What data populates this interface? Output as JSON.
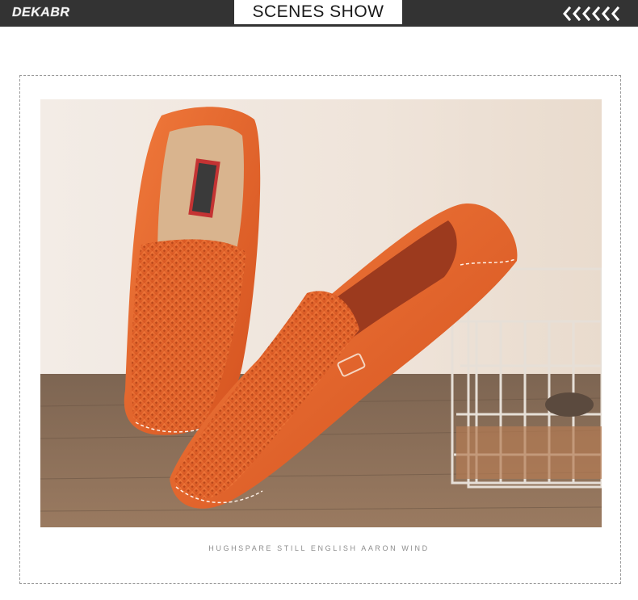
{
  "header": {
    "logo_text": "DEKABR",
    "title": "SCENES SHOW",
    "chevron_icon": "double-left-chevron-icon"
  },
  "scene": {
    "image_subject": "orange perforated leather loafers on wooden floor beside a wire basket",
    "caption": "HUGHSPARE STILL ENGLISH AARON WIND"
  },
  "colors": {
    "header_bg": "#333333",
    "shoe": "#e0622a",
    "wall": "#efe4da",
    "floor": "#8a6a52"
  }
}
